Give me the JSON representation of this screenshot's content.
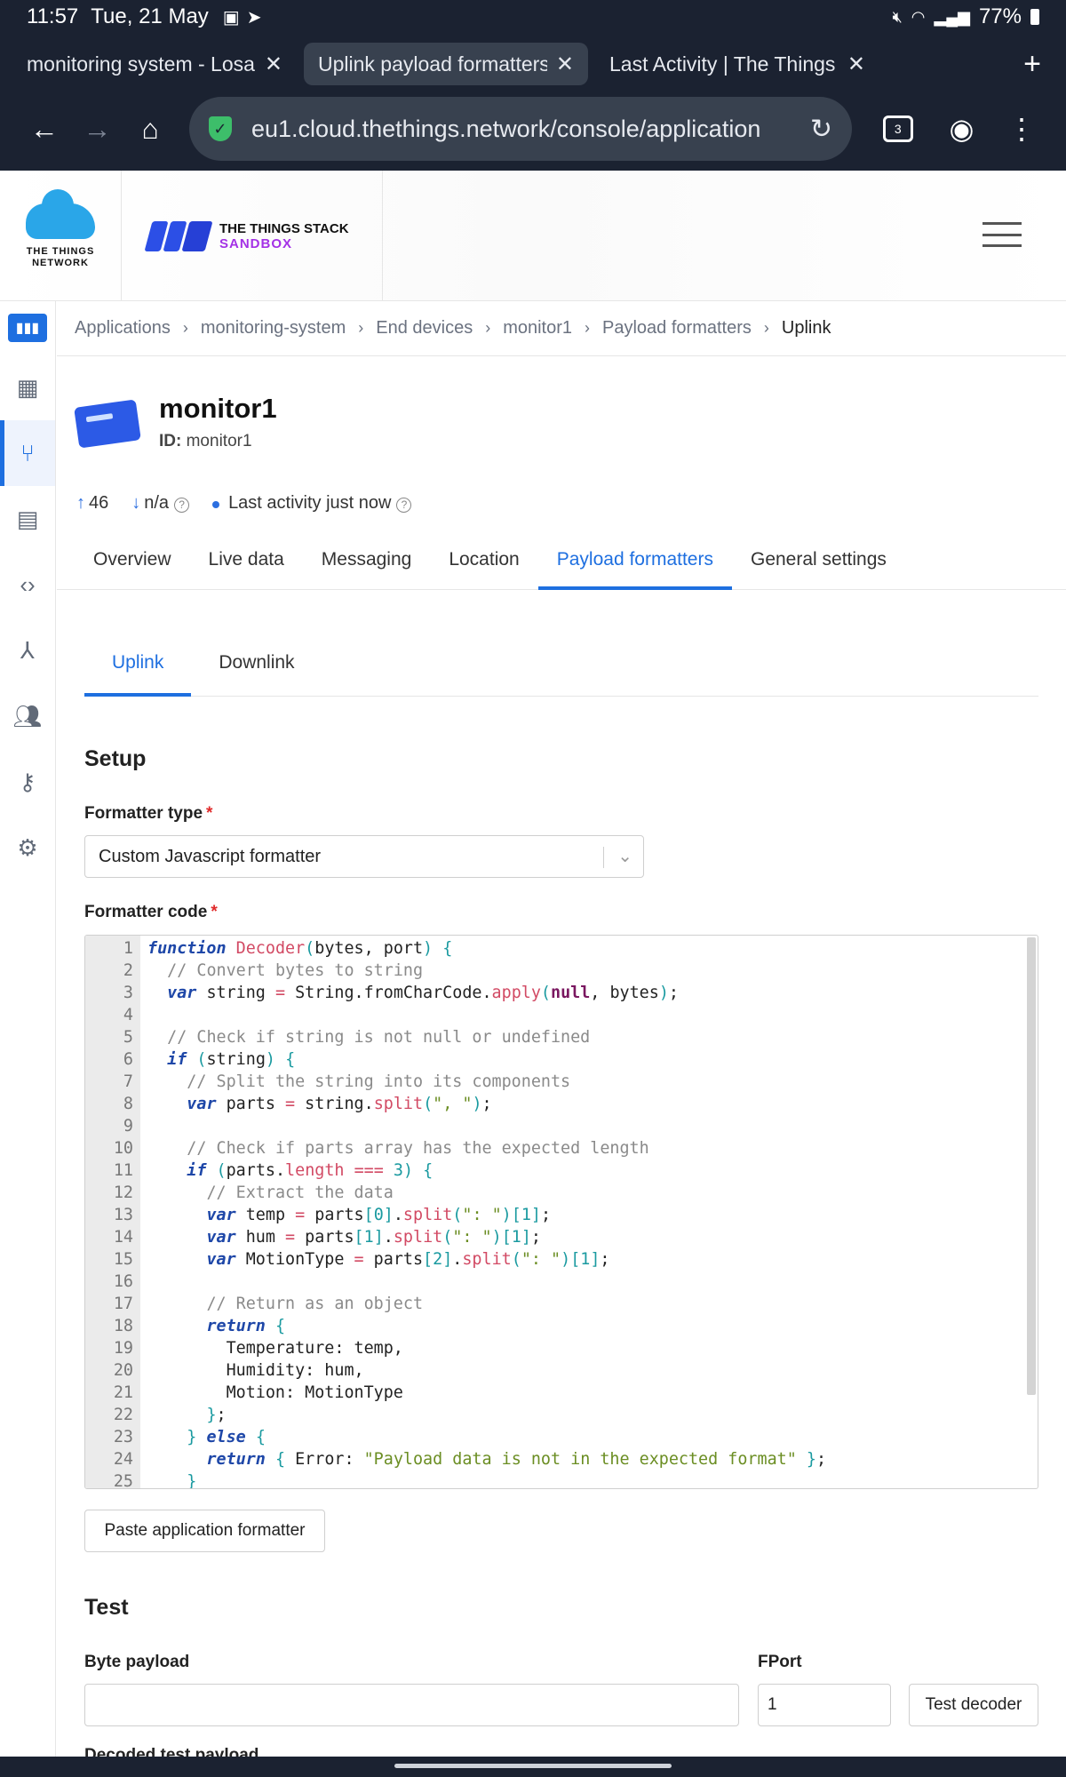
{
  "status": {
    "time": "11:57",
    "date": "Tue, 21 May",
    "battery": "77%"
  },
  "browser": {
    "tabs": [
      {
        "title": "monitoring system - Losant"
      },
      {
        "title": "Uplink payload formatters"
      },
      {
        "title": "Last Activity | The Things"
      }
    ],
    "url": "eu1.cloud.thethings.network/console/application",
    "tab_count": "3"
  },
  "site": {
    "ttn_logo_line1": "THE THINGS",
    "ttn_logo_line2": "NETWORK",
    "tts_line1": "THE THINGS STACK",
    "tts_line2": "SANDBOX"
  },
  "breadcrumb": [
    "Applications",
    "monitoring-system",
    "End devices",
    "monitor1",
    "Payload formatters",
    "Uplink"
  ],
  "device": {
    "name": "monitor1",
    "id_label": "ID:",
    "id_value": "monitor1",
    "uplink_count": "46",
    "downlink_count": "n/a",
    "last_activity": "Last activity just now"
  },
  "device_tabs": [
    "Overview",
    "Live data",
    "Messaging",
    "Location",
    "Payload formatters",
    "General settings"
  ],
  "sub_tabs": [
    "Uplink",
    "Downlink"
  ],
  "setup": {
    "heading": "Setup",
    "formatter_type_label": "Formatter type",
    "formatter_type_value": "Custom Javascript formatter",
    "formatter_code_label": "Formatter code"
  },
  "code_lines": [
    "function Decoder(bytes, port) {",
    "  // Convert bytes to string",
    "  var string = String.fromCharCode.apply(null, bytes);",
    "",
    "  // Check if string is not null or undefined",
    "  if (string) {",
    "    // Split the string into its components",
    "    var parts = string.split(\", \");",
    "",
    "    // Check if parts array has the expected length",
    "    if (parts.length === 3) {",
    "      // Extract the data",
    "      var temp = parts[0].split(\": \")[1];",
    "      var hum = parts[1].split(\": \")[1];",
    "      var MotionType = parts[2].split(\": \")[1];",
    "",
    "      // Return as an object",
    "      return {",
    "        Temperature: temp,",
    "        Humidity: hum,",
    "        Motion: MotionType",
    "      };",
    "    } else {",
    "      return { Error: \"Payload data is not in the expected format\" };",
    "    }"
  ],
  "paste_button": "Paste application formatter",
  "test": {
    "heading": "Test",
    "byte_payload_label": "Byte payload",
    "byte_payload_value": "",
    "fport_label": "FPort",
    "fport_value": "1",
    "test_button": "Test decoder",
    "decoded_label": "Decoded test payload"
  }
}
